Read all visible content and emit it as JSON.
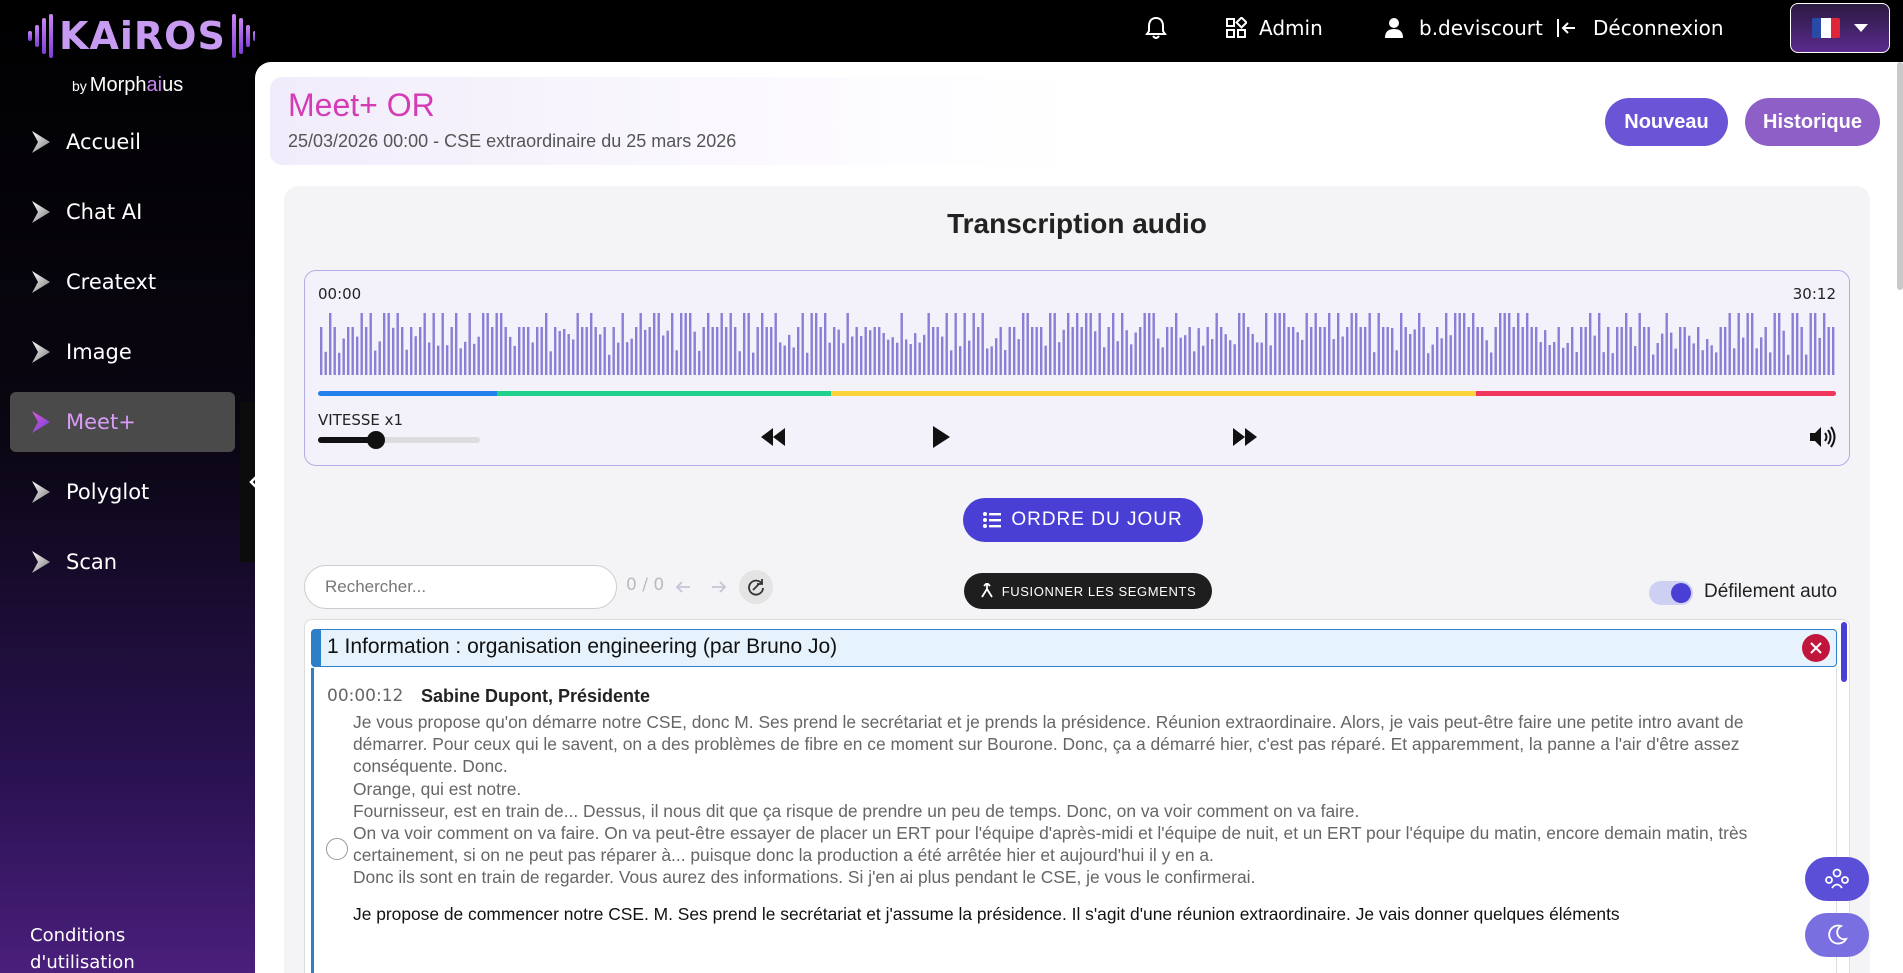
{
  "brand": {
    "name": "KAiROS",
    "by": "by",
    "company": "Morph",
    "company_ai": "ai",
    "company_end": "us"
  },
  "nav": [
    {
      "label": "Accueil"
    },
    {
      "label": "Chat AI"
    },
    {
      "label": "Creatext"
    },
    {
      "label": "Image"
    },
    {
      "label": "Meet+"
    },
    {
      "label": "Polyglot"
    },
    {
      "label": "Scan"
    }
  ],
  "nav_active": "Meet+",
  "terms": {
    "line1": "Conditions",
    "line2": "d'utilisation"
  },
  "topbar": {
    "admin": "Admin",
    "user": "b.deviscourt",
    "logout": "Déconnexion"
  },
  "header": {
    "title": "Meet+ OR",
    "subtitle": "25/03/2026 00:00 - CSE extraordinaire du 25 mars 2026",
    "new_label": "Nouveau",
    "history_label": "Historique"
  },
  "panel": {
    "title": "Transcription audio"
  },
  "player": {
    "time_start": "00:00",
    "time_end": "30:12",
    "speed_label": "VITESSE x1",
    "speed_level": 0.36,
    "segments": [
      {
        "color": "#2680eb",
        "fraction": 0.118
      },
      {
        "color": "#1fd18a",
        "fraction": 0.22
      },
      {
        "color": "#ffd43b",
        "fraction": 0.425
      },
      {
        "color": "#f0365c",
        "fraction": 0.237
      }
    ]
  },
  "agenda_label": "ORDRE DU JOUR",
  "search": {
    "placeholder": "Rechercher...",
    "count": "0 / 0"
  },
  "merge_label": "FUSIONNER LES SEGMENTS",
  "autoscroll_label": "Défilement auto",
  "colors": {
    "accent": "#4a3fd4",
    "title_pink": "#d43cb5",
    "close_red": "#c0163d"
  },
  "topic": {
    "title": "1 Information : organisation engineering (par Bruno Jo)"
  },
  "segment": {
    "time": "00:00:12",
    "speaker": "Sabine Dupont, Présidente",
    "lines": [
      "Je vous propose qu'on démarre notre CSE, donc M. Ses prend le secrétariat et je prends la présidence. Réunion extraordinaire. Alors, je vais peut-être faire une petite intro avant de démarrer. Pour ceux qui le savent, on a des problèmes de fibre en ce moment sur Bourone. Donc, ça a démarré hier, c'est pas réparé. Et apparemment, la panne a l'air d'être assez conséquente. Donc.",
      "Orange, qui est notre.",
      "Fournisseur, est en train de... Dessus, il nous dit que ça risque de prendre un peu de temps. Donc, on va voir comment on va faire.",
      "On va voir comment on va faire. On va peut-être essayer de placer un ERT pour l'équipe d'après-midi et l'équipe de nuit, et un ERT pour l'équipe du matin, encore demain matin, très certainement, si on ne peut pas réparer à... puisque donc la production a été arrêtée hier et aujourd'hui il y en a.",
      "Donc ils sont en train de regarder. Vous aurez des informations. Si j'en ai plus pendant le CSE, je vous le confirmerai."
    ],
    "rewritten": "Je propose de commencer notre CSE. M. Ses prend le secrétariat et j'assume la présidence. Il s'agit d'une réunion extraordinaire. Je vais donner quelques éléments"
  }
}
